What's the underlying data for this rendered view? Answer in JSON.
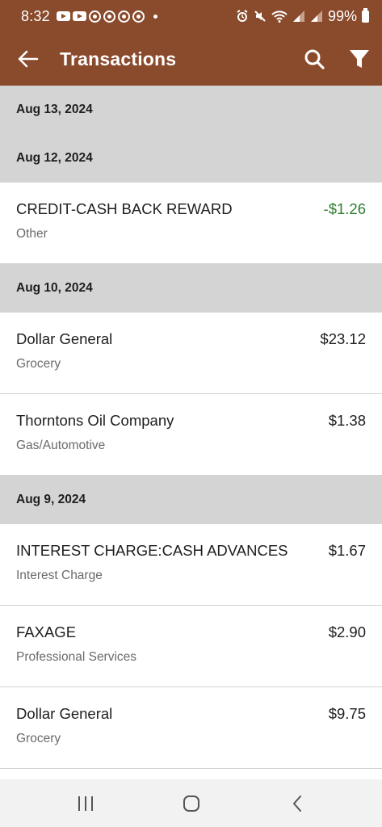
{
  "status_bar": {
    "time": "8:32",
    "battery": "99%"
  },
  "app_bar": {
    "title": "Transactions"
  },
  "groups": [
    {
      "date": "Aug 13, 2024",
      "items": []
    },
    {
      "date": "Aug 12, 2024",
      "items": [
        {
          "name": "CREDIT-CASH BACK REWARD",
          "category": "Other",
          "amount": "-$1.26",
          "credit": true
        }
      ]
    },
    {
      "date": "Aug 10, 2024",
      "items": [
        {
          "name": "Dollar General",
          "category": "Grocery",
          "amount": "$23.12"
        },
        {
          "name": "Thorntons Oil Company",
          "category": "Gas/Automotive",
          "amount": "$1.38"
        }
      ]
    },
    {
      "date": "Aug 9, 2024",
      "items": [
        {
          "name": "INTEREST CHARGE:CASH ADVANCES",
          "category": "Interest Charge",
          "amount": "$1.67"
        },
        {
          "name": "FAXAGE",
          "category": "Professional Services",
          "amount": "$2.90"
        },
        {
          "name": "Dollar General",
          "category": "Grocery",
          "amount": "$9.75"
        }
      ]
    }
  ],
  "colors": {
    "app_bar": "#8a4a2c",
    "credit_amount": "#2e7d32",
    "date_header": "#d4d4d4"
  }
}
